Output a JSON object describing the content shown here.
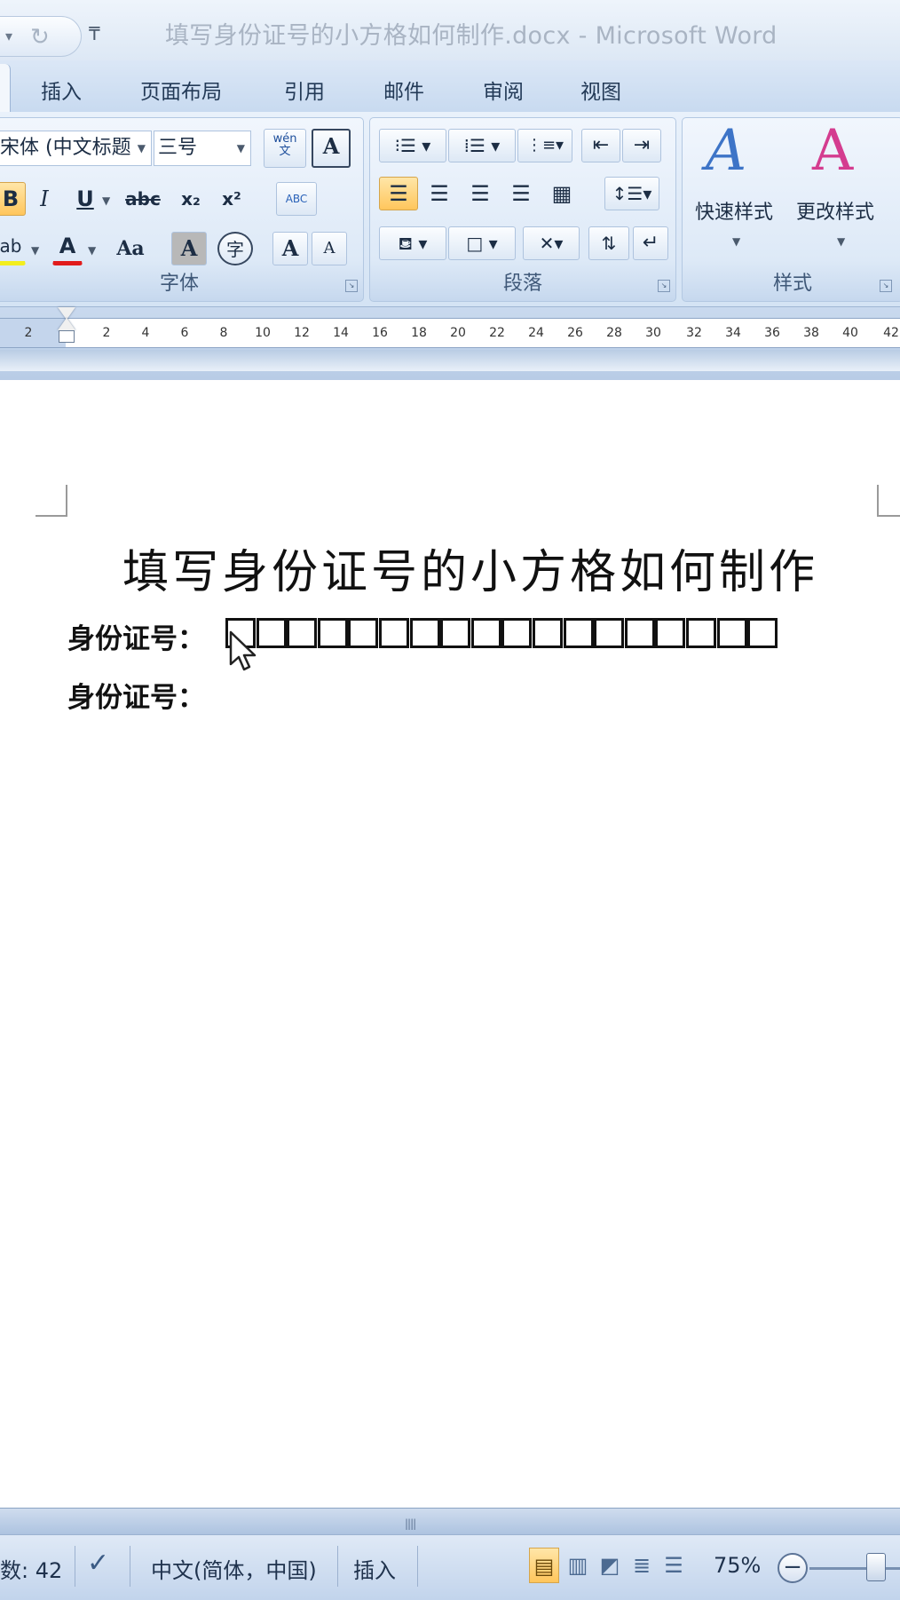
{
  "app": {
    "window_title": "填写身份证号的小方格如何制作.docx - Microsoft Word"
  },
  "qat": {
    "undo_dropdown": "▾",
    "redo_icon": "↻",
    "customize": "₸"
  },
  "tabs": [
    "插入",
    "页面布局",
    "引用",
    "邮件",
    "审阅",
    "视图"
  ],
  "ribbon": {
    "font_group": {
      "label": "字体",
      "font_name": "宋体 (中文标题",
      "font_size": "三号",
      "phonetic_label": "wén\n文",
      "char_border_label": "A",
      "bold": "B",
      "italic": "I",
      "underline": "U",
      "strikethrough": "abc",
      "subscript": "x₂",
      "superscript": "x²",
      "clear_format": "ABC",
      "highlight": "ab",
      "font_color": "A",
      "change_case": "Aa",
      "char_shading": "A",
      "enclose_char": "字",
      "grow_font": "A",
      "shrink_font": "A"
    },
    "paragraph_group": {
      "label": "段落"
    },
    "styles_group": {
      "label": "样式",
      "quick_styles": "快速样式",
      "change_styles": "更改样式"
    }
  },
  "ruler": {
    "ticks": [
      "2",
      "2",
      "4",
      "6",
      "8",
      "10",
      "12",
      "14",
      "16",
      "18",
      "20",
      "22",
      "24",
      "26",
      "28",
      "30",
      "32",
      "34",
      "36",
      "38",
      "40",
      "42"
    ]
  },
  "document": {
    "heading": "填写身份证号的小方格如何制作",
    "id_label_1": "身份证号：",
    "id_label_2": "身份证号：",
    "box_count": 18
  },
  "status": {
    "word_count": "数: 42",
    "language": "中文(简体，中国)",
    "insert_mode": "插入",
    "zoom": "75%"
  },
  "colors": {
    "ribbon_blue": "#d4e3f4",
    "active_orange": "#ffc65c",
    "font_color_red": "#e11b1b",
    "highlight_yellow": "#f3ee1d",
    "style_icon_blue": "#3d74c7",
    "style_icon_pink": "#d43c8f"
  }
}
